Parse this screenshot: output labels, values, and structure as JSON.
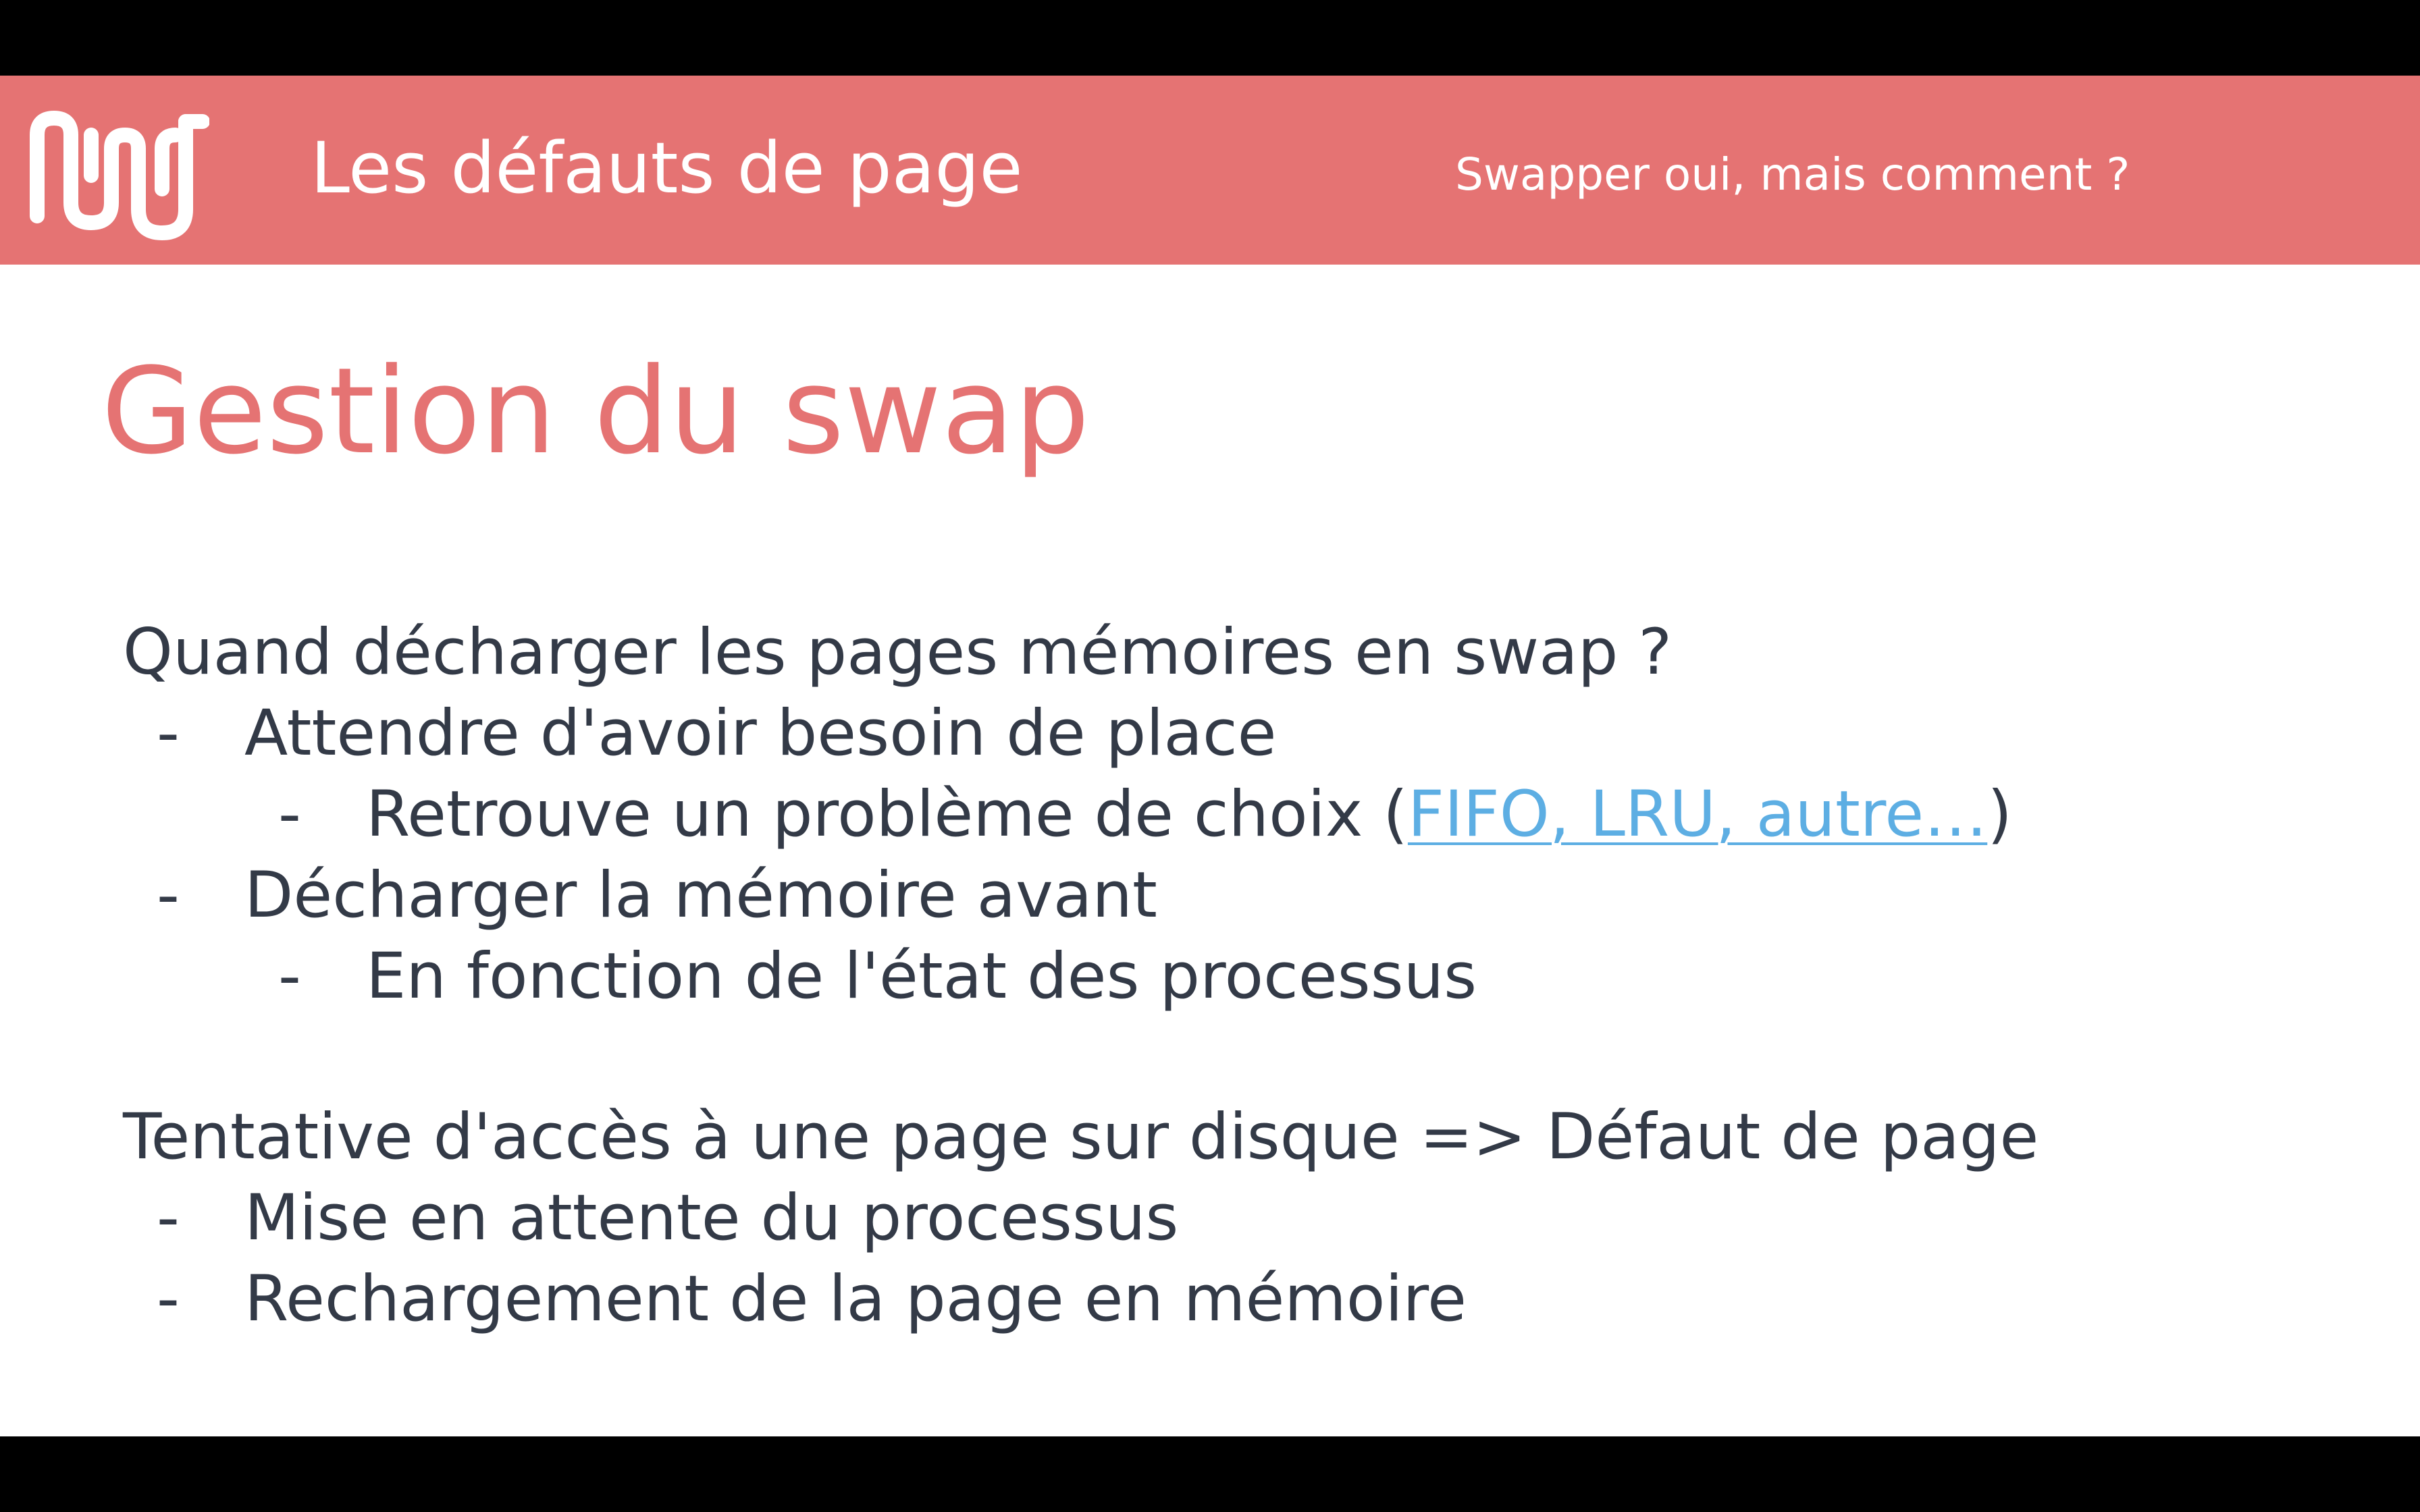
{
  "header": {
    "title": "Les défauts de page",
    "subtitle": "Swapper oui, mais comment ?",
    "logo_icon": "wavy-line-logo-icon"
  },
  "slide": {
    "title": "Gestion du swap",
    "sections": [
      {
        "heading": "Quand décharger les pages mémoires en swap ?",
        "items": [
          {
            "level": 1,
            "dash": "-",
            "text": "Attendre d'avoir besoin de place"
          },
          {
            "level": 2,
            "dash": "-",
            "text_before": "Retrouve un problème de choix (",
            "link_text": "FIFO, LRU, autre…",
            "text_after": ")"
          },
          {
            "level": 1,
            "dash": "-",
            "text": "Décharger la mémoire avant"
          },
          {
            "level": 2,
            "dash": "-",
            "text": "En fonction de l'état des processus"
          }
        ]
      },
      {
        "heading": "Tentative d'accès à une page sur disque => Défaut de page",
        "items": [
          {
            "level": 1,
            "dash": "-",
            "text": "Mise en attente du processus"
          },
          {
            "level": 1,
            "dash": "-",
            "text": "Rechargement de la page en mémoire"
          }
        ]
      }
    ]
  },
  "colors": {
    "header_bg": "#e57373",
    "title": "#e57373",
    "body_text": "#333a47",
    "link": "#5daee3",
    "letterbox": "#000000"
  }
}
